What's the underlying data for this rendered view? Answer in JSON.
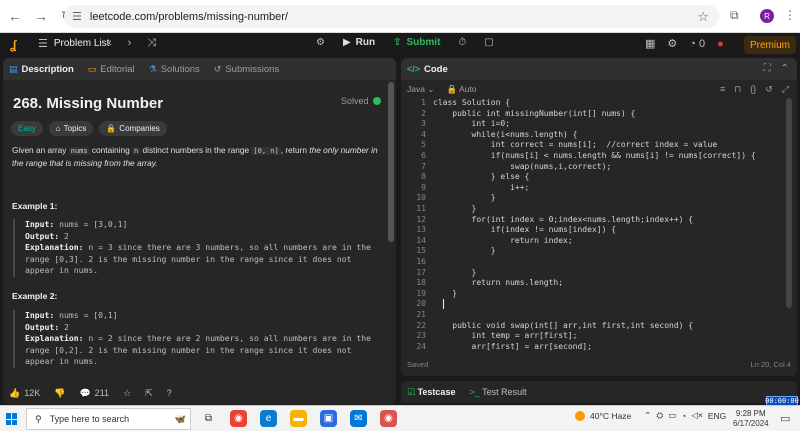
{
  "browser": {
    "url": "leetcode.com/problems/missing-number/",
    "profile_initial": "R"
  },
  "nav": {
    "problem_list": "Problem List",
    "run": "Run",
    "submit": "Submit",
    "coins": "0",
    "premium": "Premium"
  },
  "left_tabs": [
    "Description",
    "Editorial",
    "Solutions",
    "Submissions"
  ],
  "problem": {
    "title": "268. Missing Number",
    "status": "Solved",
    "difficulty": "Easy",
    "topics": "Topics",
    "companies": "Companies",
    "desc_1": "Given an array ",
    "desc_code1": "nums",
    "desc_2": " containing ",
    "desc_code2": "n",
    "desc_3": " distinct numbers in the range ",
    "desc_code3": "[0, n]",
    "desc_4": ", return ",
    "desc_em": "the only number in the range that is missing from the array.",
    "examples": [
      {
        "title": "Example 1:",
        "input_label": "Input:",
        "input": " nums = [3,0,1]",
        "output_label": "Output:",
        "output": " 2",
        "expl_label": "Explanation:",
        "expl": " n = 3 since there are 3 numbers, so all numbers are in the range [0,3]. 2 is the missing number in the range since it does not appear in nums."
      },
      {
        "title": "Example 2:",
        "input_label": "Input:",
        "input": " nums = [0,1]",
        "output_label": "Output:",
        "output": " 2",
        "expl_label": "Explanation:",
        "expl": " n = 2 since there are 2 numbers, so all numbers are in the range [0,2]. 2 is the missing number in the range since it does not appear in nums."
      }
    ],
    "likes": "12K",
    "comments": "211"
  },
  "code_panel": {
    "tab": "Code",
    "language": "Java",
    "mode": "Auto",
    "status_left": "Saved",
    "status_right": "Ln 20, Col 4",
    "lines": [
      {
        "n": "1",
        "t": "class Solution {"
      },
      {
        "n": "2",
        "t": "    public int missingNumber(int[] nums) {"
      },
      {
        "n": "3",
        "t": "        int i=0;"
      },
      {
        "n": "4",
        "t": "        while(i<nums.length) {"
      },
      {
        "n": "5",
        "t": "            int correct = nums[i];  //correct index = value"
      },
      {
        "n": "6",
        "t": "            if(nums[i] < nums.length && nums[i] != nums[correct]) {"
      },
      {
        "n": "7",
        "t": "                swap(nums,i,correct);"
      },
      {
        "n": "8",
        "t": "            } else {"
      },
      {
        "n": "9",
        "t": "                i++;"
      },
      {
        "n": "10",
        "t": "            }"
      },
      {
        "n": "11",
        "t": "        }"
      },
      {
        "n": "12",
        "t": "        for(int index = 0;index<nums.length;index++) {"
      },
      {
        "n": "13",
        "t": "            if(index != nums[index]) {"
      },
      {
        "n": "14",
        "t": "                return index;"
      },
      {
        "n": "15",
        "t": "            }"
      },
      {
        "n": "16",
        "t": ""
      },
      {
        "n": "17",
        "t": "        }"
      },
      {
        "n": "18",
        "t": "        return nums.length;"
      },
      {
        "n": "19",
        "t": "    }"
      },
      {
        "n": "20",
        "t": ""
      },
      {
        "n": "21",
        "t": ""
      },
      {
        "n": "22",
        "t": "    public void swap(int[] arr,int first,int second) {"
      },
      {
        "n": "23",
        "t": "        int temp = arr[first];"
      },
      {
        "n": "24",
        "t": "        arr[first] = arr[second];"
      }
    ]
  },
  "bottom_tabs": {
    "testcase": "Testcase",
    "test_result": "Test Result",
    "timer": "00:00:00"
  },
  "taskbar": {
    "search_placeholder": "Type here to search",
    "weather": "40°C  Haze",
    "lang": "ENG",
    "time": "9:28 PM",
    "date": "6/17/2024"
  }
}
